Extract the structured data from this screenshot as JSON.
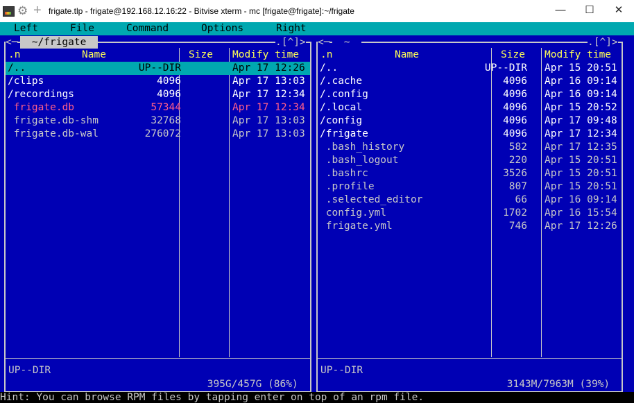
{
  "window": {
    "title": "frigate.tlp - frigate@192.168.12.16:22 - Bitvise xterm - mc [frigate@frigate]:~/frigate",
    "app_icon": "terminal-icon",
    "minimize": "—",
    "maximize": "☐",
    "close": "✕"
  },
  "menu": {
    "left": "Left",
    "file": "File",
    "command": "Command",
    "options": "Options",
    "right": "Right"
  },
  "left_panel": {
    "title": " ~/frigate ",
    "corner_left": "<─",
    "corner_right": ".[^]>",
    "col_n": ".n",
    "col_name": "Name",
    "col_size": "Size",
    "col_modify": "Modify time",
    "files": [
      {
        "name": "/..",
        "size": "UP--DIR",
        "time": "Apr 17 12:26",
        "kind": "selected"
      },
      {
        "name": "/clips",
        "size": "4096",
        "time": "Apr 17 13:03",
        "kind": "dir"
      },
      {
        "name": "/recordings",
        "size": "4096",
        "time": "Apr 17 12:34",
        "kind": "dir"
      },
      {
        "name": " frigate.db",
        "size": "57344",
        "time": "Apr 17 12:34",
        "kind": "special"
      },
      {
        "name": " frigate.db-shm",
        "size": "32768",
        "time": "Apr 17 13:03",
        "kind": "plain"
      },
      {
        "name": " frigate.db-wal",
        "size": "276072",
        "time": "Apr 17 13:03",
        "kind": "plain"
      }
    ],
    "mini_status": "UP--DIR",
    "disk": " 395G/457G (86%) "
  },
  "right_panel": {
    "title": " ~ ",
    "corner_left": "<─",
    "corner_right": ".[^]>",
    "col_n": ".n",
    "col_name": "Name",
    "col_size": "Size",
    "col_modify": "Modify time",
    "files": [
      {
        "name": "/..",
        "size": "UP--DIR",
        "time": "Apr 15 20:51",
        "kind": "dir"
      },
      {
        "name": "/.cache",
        "size": "4096",
        "time": "Apr 16 09:14",
        "kind": "dir"
      },
      {
        "name": "/.config",
        "size": "4096",
        "time": "Apr 16 09:14",
        "kind": "dir"
      },
      {
        "name": "/.local",
        "size": "4096",
        "time": "Apr 15 20:52",
        "kind": "dir"
      },
      {
        "name": "/config",
        "size": "4096",
        "time": "Apr 17 09:48",
        "kind": "dir"
      },
      {
        "name": "/frigate",
        "size": "4096",
        "time": "Apr 17 12:34",
        "kind": "dir"
      },
      {
        "name": " .bash_history",
        "size": "582",
        "time": "Apr 17 12:35",
        "kind": "plain"
      },
      {
        "name": " .bash_logout",
        "size": "220",
        "time": "Apr 15 20:51",
        "kind": "plain"
      },
      {
        "name": " .bashrc",
        "size": "3526",
        "time": "Apr 15 20:51",
        "kind": "plain"
      },
      {
        "name": " .profile",
        "size": "807",
        "time": "Apr 15 20:51",
        "kind": "plain"
      },
      {
        "name": " .selected_editor",
        "size": "66",
        "time": "Apr 16 09:14",
        "kind": "plain"
      },
      {
        "name": " config.yml",
        "size": "1702",
        "time": "Apr 16 15:54",
        "kind": "plain"
      },
      {
        "name": " frigate.yml",
        "size": "746",
        "time": "Apr 17 12:26",
        "kind": "plain"
      }
    ],
    "mini_status": "UP--DIR",
    "disk": " 3143M/7963M (39%) "
  },
  "hint": "Hint: You can browse RPM files by tapping enter on top of an rpm file.",
  "colors": {
    "terminal_bg": "#0000b4",
    "menu_bg": "#00a8b0",
    "selection_bg": "#00a8b0",
    "header_fg": "#ffff55",
    "dir_fg": "#ffffff",
    "file_fg": "#c8c8c8",
    "special_fg": "#ff5e8a"
  }
}
